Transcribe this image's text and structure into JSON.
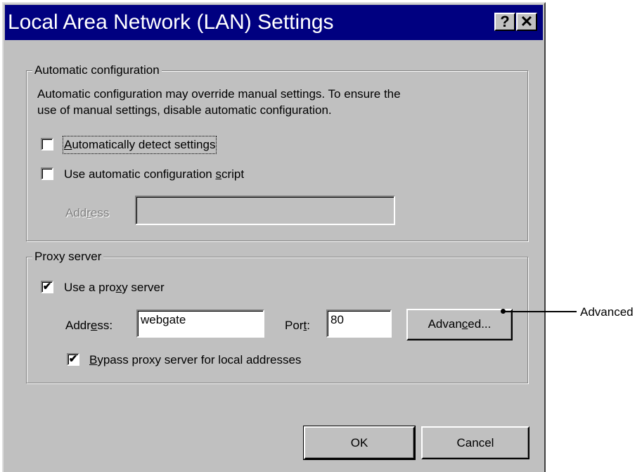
{
  "window": {
    "title": "Local Area Network (LAN) Settings",
    "help_glyph": "?",
    "close_glyph": "✕"
  },
  "automatic_config": {
    "legend": "Automatic configuration",
    "description_line1": "Automatic configuration may override manual settings.  To ensure the",
    "description_line2": "use of manual settings, disable automatic configuration.",
    "auto_detect": {
      "label_prefix": "",
      "label_accel": "A",
      "label_rest": "utomatically detect settings",
      "checked": false
    },
    "use_script": {
      "label_prefix": "Use automatic configuration ",
      "label_accel": "s",
      "label_rest": "cript",
      "checked": false
    },
    "address": {
      "label_prefix": "Add",
      "label_accel": "r",
      "label_rest": "ess",
      "value": "",
      "enabled": false
    }
  },
  "proxy_server": {
    "legend": "Proxy server",
    "use_proxy": {
      "label_prefix": "Use a pro",
      "label_accel": "x",
      "label_rest": "y server",
      "checked": true,
      "check_glyph": "✔"
    },
    "address": {
      "label_prefix": "Addr",
      "label_accel": "e",
      "label_rest": "ss:",
      "value": "webgate"
    },
    "port": {
      "label_prefix": "Por",
      "label_accel": "t",
      "label_rest": ":",
      "value": "80"
    },
    "advanced_button": {
      "label_prefix": "Advan",
      "label_accel": "c",
      "label_rest": "ed..."
    },
    "bypass_local": {
      "label_prefix": "",
      "label_accel": "B",
      "label_rest": "ypass proxy server for local addresses",
      "checked": true,
      "check_glyph": "✔"
    }
  },
  "buttons": {
    "ok": "OK",
    "cancel": "Cancel"
  },
  "callout": {
    "label": "Advanced"
  }
}
